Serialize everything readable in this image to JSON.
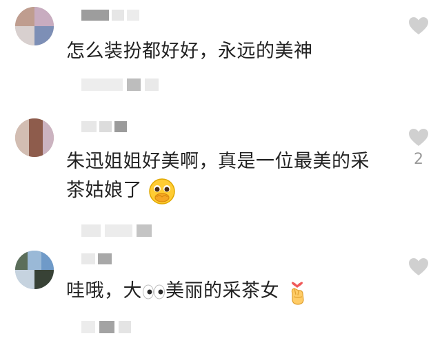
{
  "comments": [
    {
      "text": "怎么装扮都好好，永远的美神",
      "likes": ""
    },
    {
      "text_line1": "朱迅姐姐好美啊，真是一位最美的采",
      "text_line2": "茶姑娘了",
      "emoji": "pleading-face",
      "likes": "2"
    },
    {
      "text_before": "哇哦，大",
      "emoji_inline": "eyes",
      "text_after": "美丽的采茶女",
      "emoji_end": "finger-heart",
      "likes": ""
    }
  ],
  "colors": {
    "heart": "#d0d0d0",
    "text": "#222222",
    "count": "#9a9a9a"
  }
}
